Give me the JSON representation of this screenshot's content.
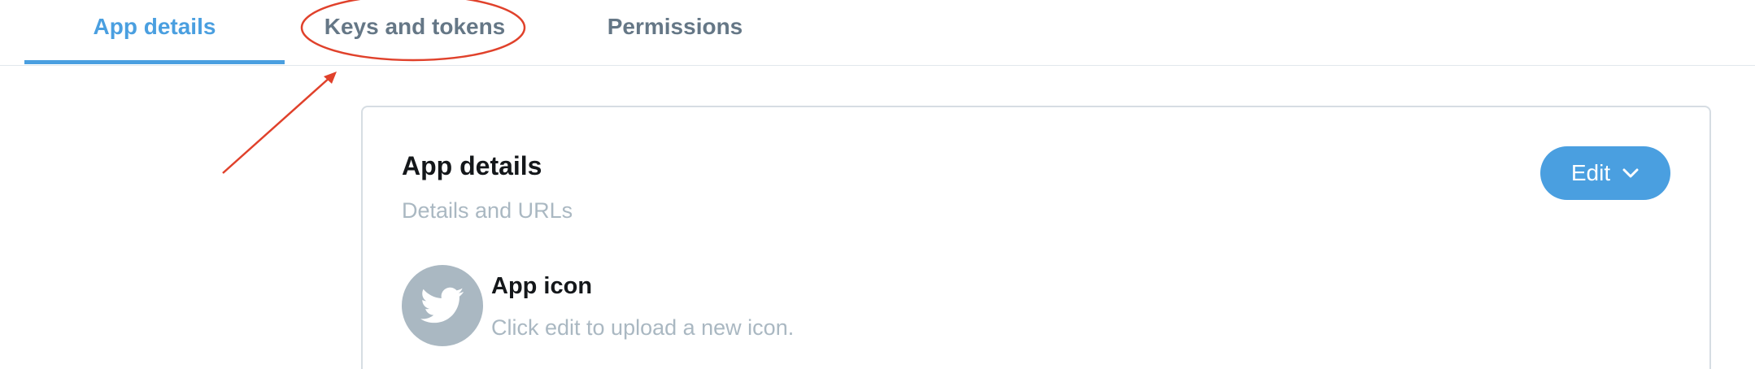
{
  "tabs": [
    {
      "label": "App details",
      "active": true
    },
    {
      "label": "Keys and tokens",
      "active": false,
      "annotated": true
    },
    {
      "label": "Permissions",
      "active": false
    }
  ],
  "card": {
    "title": "App details",
    "subtitle": "Details and URLs",
    "edit_button": {
      "label": "Edit",
      "icon": "chevron-down-icon"
    },
    "app_icon": {
      "title": "App icon",
      "description": "Click edit to upload a new icon.",
      "icon": "twitter-bird-icon"
    }
  },
  "colors": {
    "accent": "#4a9fe0",
    "annotation": "#e0412b",
    "muted_text": "#aab8c2",
    "tab_inactive": "#657786"
  }
}
